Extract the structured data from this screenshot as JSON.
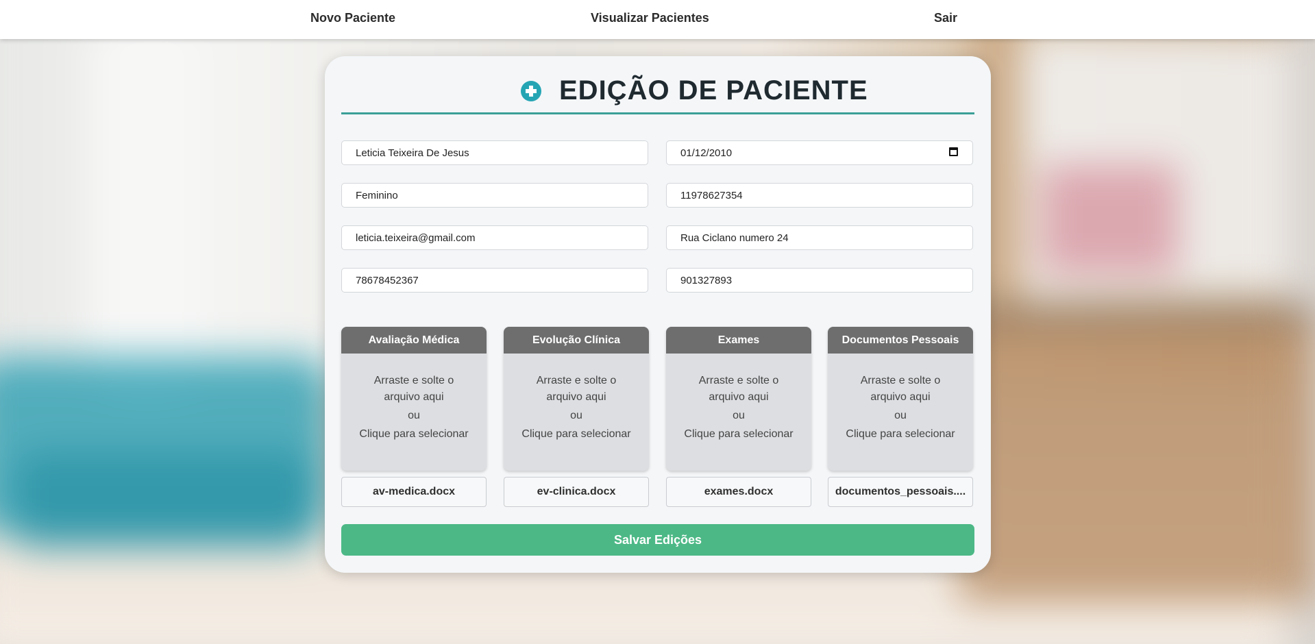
{
  "nav": {
    "new_patient": "Novo Paciente",
    "view_patients": "Visualizar Pacientes",
    "logout": "Sair"
  },
  "form": {
    "title": "EDIÇÃO DE PACIENTE",
    "title_icon": "plus-circle-icon",
    "fields": {
      "name": "Leticia Teixeira De Jesus",
      "birth_date": "01/12/2010",
      "gender": "Feminino",
      "phone": "11978627354",
      "email": "leticia.teixeira@gmail.com",
      "address": "Rua Ciclano numero 24",
      "cpf": "78678452367",
      "rg": "901327893"
    },
    "uploads": [
      {
        "header": "Avaliação Médica",
        "file": "av-medica.docx"
      },
      {
        "header": "Evolução Clínica",
        "file": "ev-clinica.docx"
      },
      {
        "header": "Exames",
        "file": "exames.docx"
      },
      {
        "header": "Documentos Pessoais",
        "file": "documentos_pessoais...."
      }
    ],
    "drop_text_1": "Arraste e solte o",
    "drop_text_2": "arquivo aqui",
    "drop_text_or": "ou",
    "drop_text_click": "Clique para selecionar",
    "save_label": "Salvar Edições"
  },
  "colors": {
    "accent": "#3a9f96",
    "icon": "#25a5b4",
    "save": "#4cb886",
    "upload_header": "#6e6e6e"
  }
}
